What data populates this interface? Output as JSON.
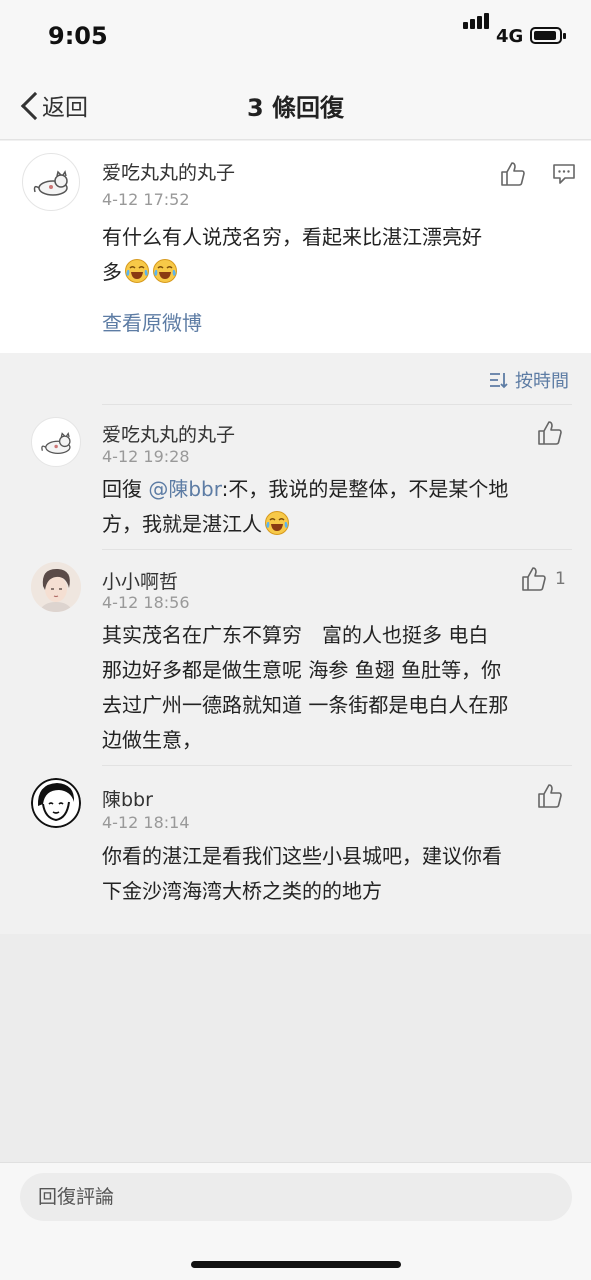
{
  "status": {
    "time": "9:05",
    "network": "4G"
  },
  "nav": {
    "back_label": "返回",
    "title": "3 條回復"
  },
  "original": {
    "name": "爱吃丸丸的丸子",
    "date": "4-12 17:52",
    "text_line1": "有什么有人说茂名穷，看起来比湛江漂亮好",
    "text_line2": "多",
    "emoji": "laugh-cry-emoji",
    "view_original": "查看原微博"
  },
  "sort": {
    "label": "按時間",
    "icon": "sort-icon"
  },
  "comments": [
    {
      "name": "爱吃丸丸的丸子",
      "date": "4-12 19:28",
      "reply_prefix": "回復 ",
      "mention": "@陳bbr",
      "line1_rest": ":不，我说的是整体，不是某个地",
      "line2": "方，我就是湛江人",
      "likes": ""
    },
    {
      "name": "小小啊哲",
      "date": "4-12 18:56",
      "line1": "其实茂名在广东不算穷　富的人也挺多 电白",
      "line2": "那边好多都是做生意呢 海参 鱼翅 鱼肚等，你",
      "line3": "去过广州一德路就知道 一条街都是电白人在那",
      "line4": "边做生意，",
      "likes": "1"
    },
    {
      "name": "陳bbr",
      "date": "4-12 18:14",
      "line1": "你看的湛江是看我们这些小县城吧，建议你看",
      "line2": "下金沙湾海湾大桥之类的的地方",
      "likes": ""
    }
  ],
  "input": {
    "placeholder": "回復評論"
  }
}
